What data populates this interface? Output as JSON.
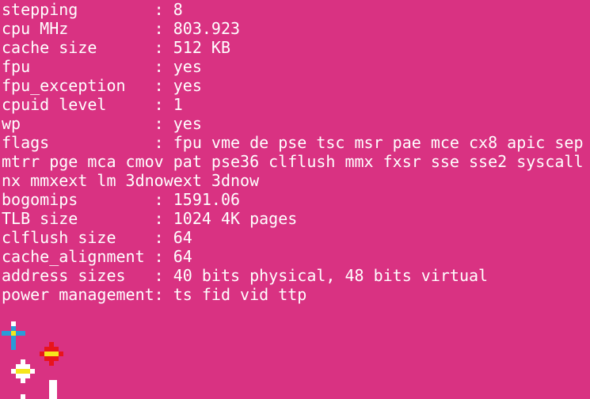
{
  "terminal": {
    "lines": [
      "stepping        : 8",
      "cpu MHz         : 803.923",
      "cache size      : 512 KB",
      "fpu             : yes",
      "fpu_exception   : yes",
      "cpuid level     : 1",
      "wp              : yes",
      "flags           : fpu vme de pse tsc msr pae mce cx8 apic sep",
      "mtrr pge mca cmov pat pse36 clflush mmx fxsr sse sse2 syscall",
      "nx mmxext lm 3dnowext 3dnow",
      "bogomips        : 1591.06",
      "TLB size        : 1024 4K pages",
      "clflush size    : 64",
      "cache_alignment : 64",
      "address sizes   : 40 bits physical, 48 bits virtual",
      "power management: ts fid vid ttp"
    ]
  },
  "colors": {
    "background": "#D93282",
    "text": "#FFFFFF",
    "icon_blue": "#2A9BD8",
    "icon_yellow": "#F6E61C",
    "icon_red": "#E8141B",
    "icon_white": "#FFFFFF"
  },
  "icons": [
    {
      "name": "blue-cross-icon"
    },
    {
      "name": "red-cross-icon"
    },
    {
      "name": "white-cross-icon"
    }
  ]
}
